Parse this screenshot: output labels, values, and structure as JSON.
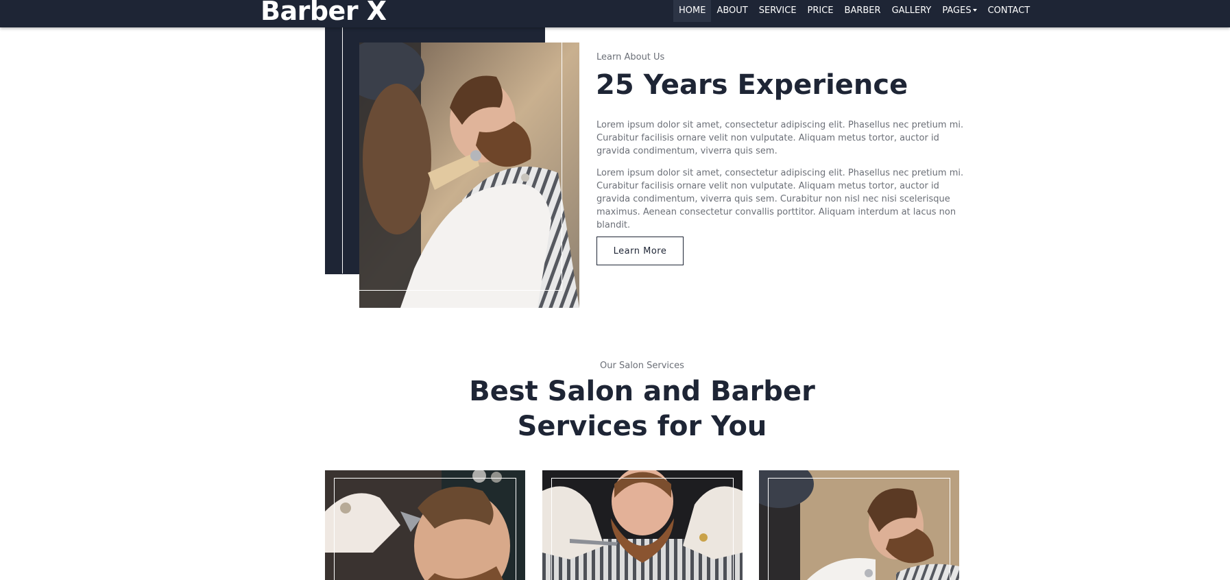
{
  "brand": {
    "name": "Barber X"
  },
  "nav": {
    "items": [
      {
        "label": "HOME",
        "active": true
      },
      {
        "label": "ABOUT"
      },
      {
        "label": "SERVICE"
      },
      {
        "label": "PRICE"
      },
      {
        "label": "BARBER"
      },
      {
        "label": "GALLERY"
      },
      {
        "label": "PAGES",
        "dropdown": true
      },
      {
        "label": "CONTACT"
      }
    ]
  },
  "about": {
    "subtitle": "Learn About Us",
    "title": "25 Years Experience",
    "paragraph1": "Lorem ipsum dolor sit amet, consectetur adipiscing elit. Phasellus nec pretium mi. Curabitur facilisis ornare velit non vulputate. Aliquam metus tortor, auctor id gravida condimentum, viverra quis sem.",
    "paragraph2": "Lorem ipsum dolor sit amet, consectetur adipiscing elit. Phasellus nec pretium mi. Curabitur facilisis ornare velit non vulputate. Aliquam metus tortor, auctor id gravida condimentum, viverra quis sem. Curabitur non nisl nec nisi scelerisque maximus. Aenean consectetur convallis porttitor. Aliquam interdum at lacus non blandit.",
    "button": "Learn More"
  },
  "services": {
    "subtitle": "Our Salon Services",
    "title_line1": "Best Salon and Barber",
    "title_line2": "Services for You"
  },
  "colors": {
    "navy": "#1e2535",
    "text_muted": "#6b6f77",
    "white": "#ffffff"
  }
}
